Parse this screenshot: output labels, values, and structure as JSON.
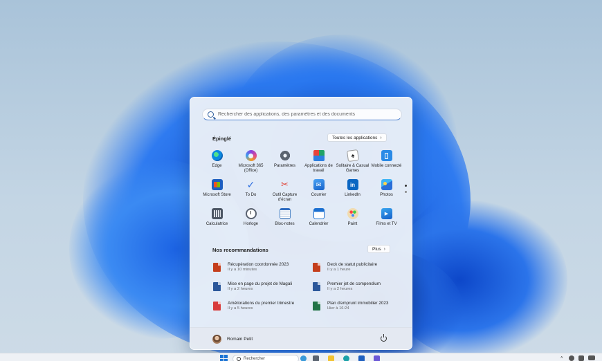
{
  "search": {
    "placeholder": "Rechercher des applications, des paramètres et des documents"
  },
  "pinned": {
    "title": "Épinglé",
    "all_apps_label": "Toutes les applications",
    "apps": [
      {
        "label": "Edge",
        "icon": "edge-icon"
      },
      {
        "label": "Microsoft 365 (Office)",
        "icon": "microsoft-365-icon"
      },
      {
        "label": "Paramètres",
        "icon": "settings-gear-icon"
      },
      {
        "label": "Applications de travail",
        "icon": "work-apps-icon"
      },
      {
        "label": "Solitaire & Casual Games",
        "icon": "solitaire-icon"
      },
      {
        "label": "Mobile connecté",
        "icon": "phone-link-icon"
      },
      {
        "label": "Microsoft Store",
        "icon": "store-icon"
      },
      {
        "label": "To Do",
        "icon": "todo-check-icon"
      },
      {
        "label": "Outil Capture d'écran",
        "icon": "snipping-tool-icon"
      },
      {
        "label": "Courrier",
        "icon": "mail-icon"
      },
      {
        "label": "LinkedIn",
        "icon": "linkedin-icon"
      },
      {
        "label": "Photos",
        "icon": "photos-icon"
      },
      {
        "label": "Calculatrice",
        "icon": "calculator-icon"
      },
      {
        "label": "Horloge",
        "icon": "clock-icon"
      },
      {
        "label": "Bloc-notes",
        "icon": "notepad-icon"
      },
      {
        "label": "Calendrier",
        "icon": "calendar-icon"
      },
      {
        "label": "Paint",
        "icon": "paint-palette-icon"
      },
      {
        "label": "Films et TV",
        "icon": "films-tv-icon"
      }
    ]
  },
  "recommendations": {
    "title": "Nos recommandations",
    "more_label": "Plus",
    "items": [
      {
        "title": "Récupération coordonnée 2023",
        "time": "Il y a 10 minutes",
        "type": "powerpoint"
      },
      {
        "title": "Deck de statut publicitaire",
        "time": "Il y a 1 heure",
        "type": "powerpoint"
      },
      {
        "title": "Mise en page du projet de Magali",
        "time": "Il y a 2 heures",
        "type": "word"
      },
      {
        "title": "Premier jet de compendium",
        "time": "Il y a 2 heures",
        "type": "word"
      },
      {
        "title": "Améliorations du premier trimestre",
        "time": "Il y a 5 heures",
        "type": "pdf"
      },
      {
        "title": "Plan d'emprunt immobilier 2023",
        "time": "Hier à 16:24",
        "type": "excel"
      }
    ]
  },
  "user": {
    "name": "Romain Petit"
  },
  "taskbar": {
    "search_label": "Rechercher"
  },
  "colors": {
    "accent": "#1b73d4",
    "powerpoint": "#c43e1c",
    "word": "#2b579a",
    "excel": "#217346",
    "pdf": "#d83b3b"
  }
}
